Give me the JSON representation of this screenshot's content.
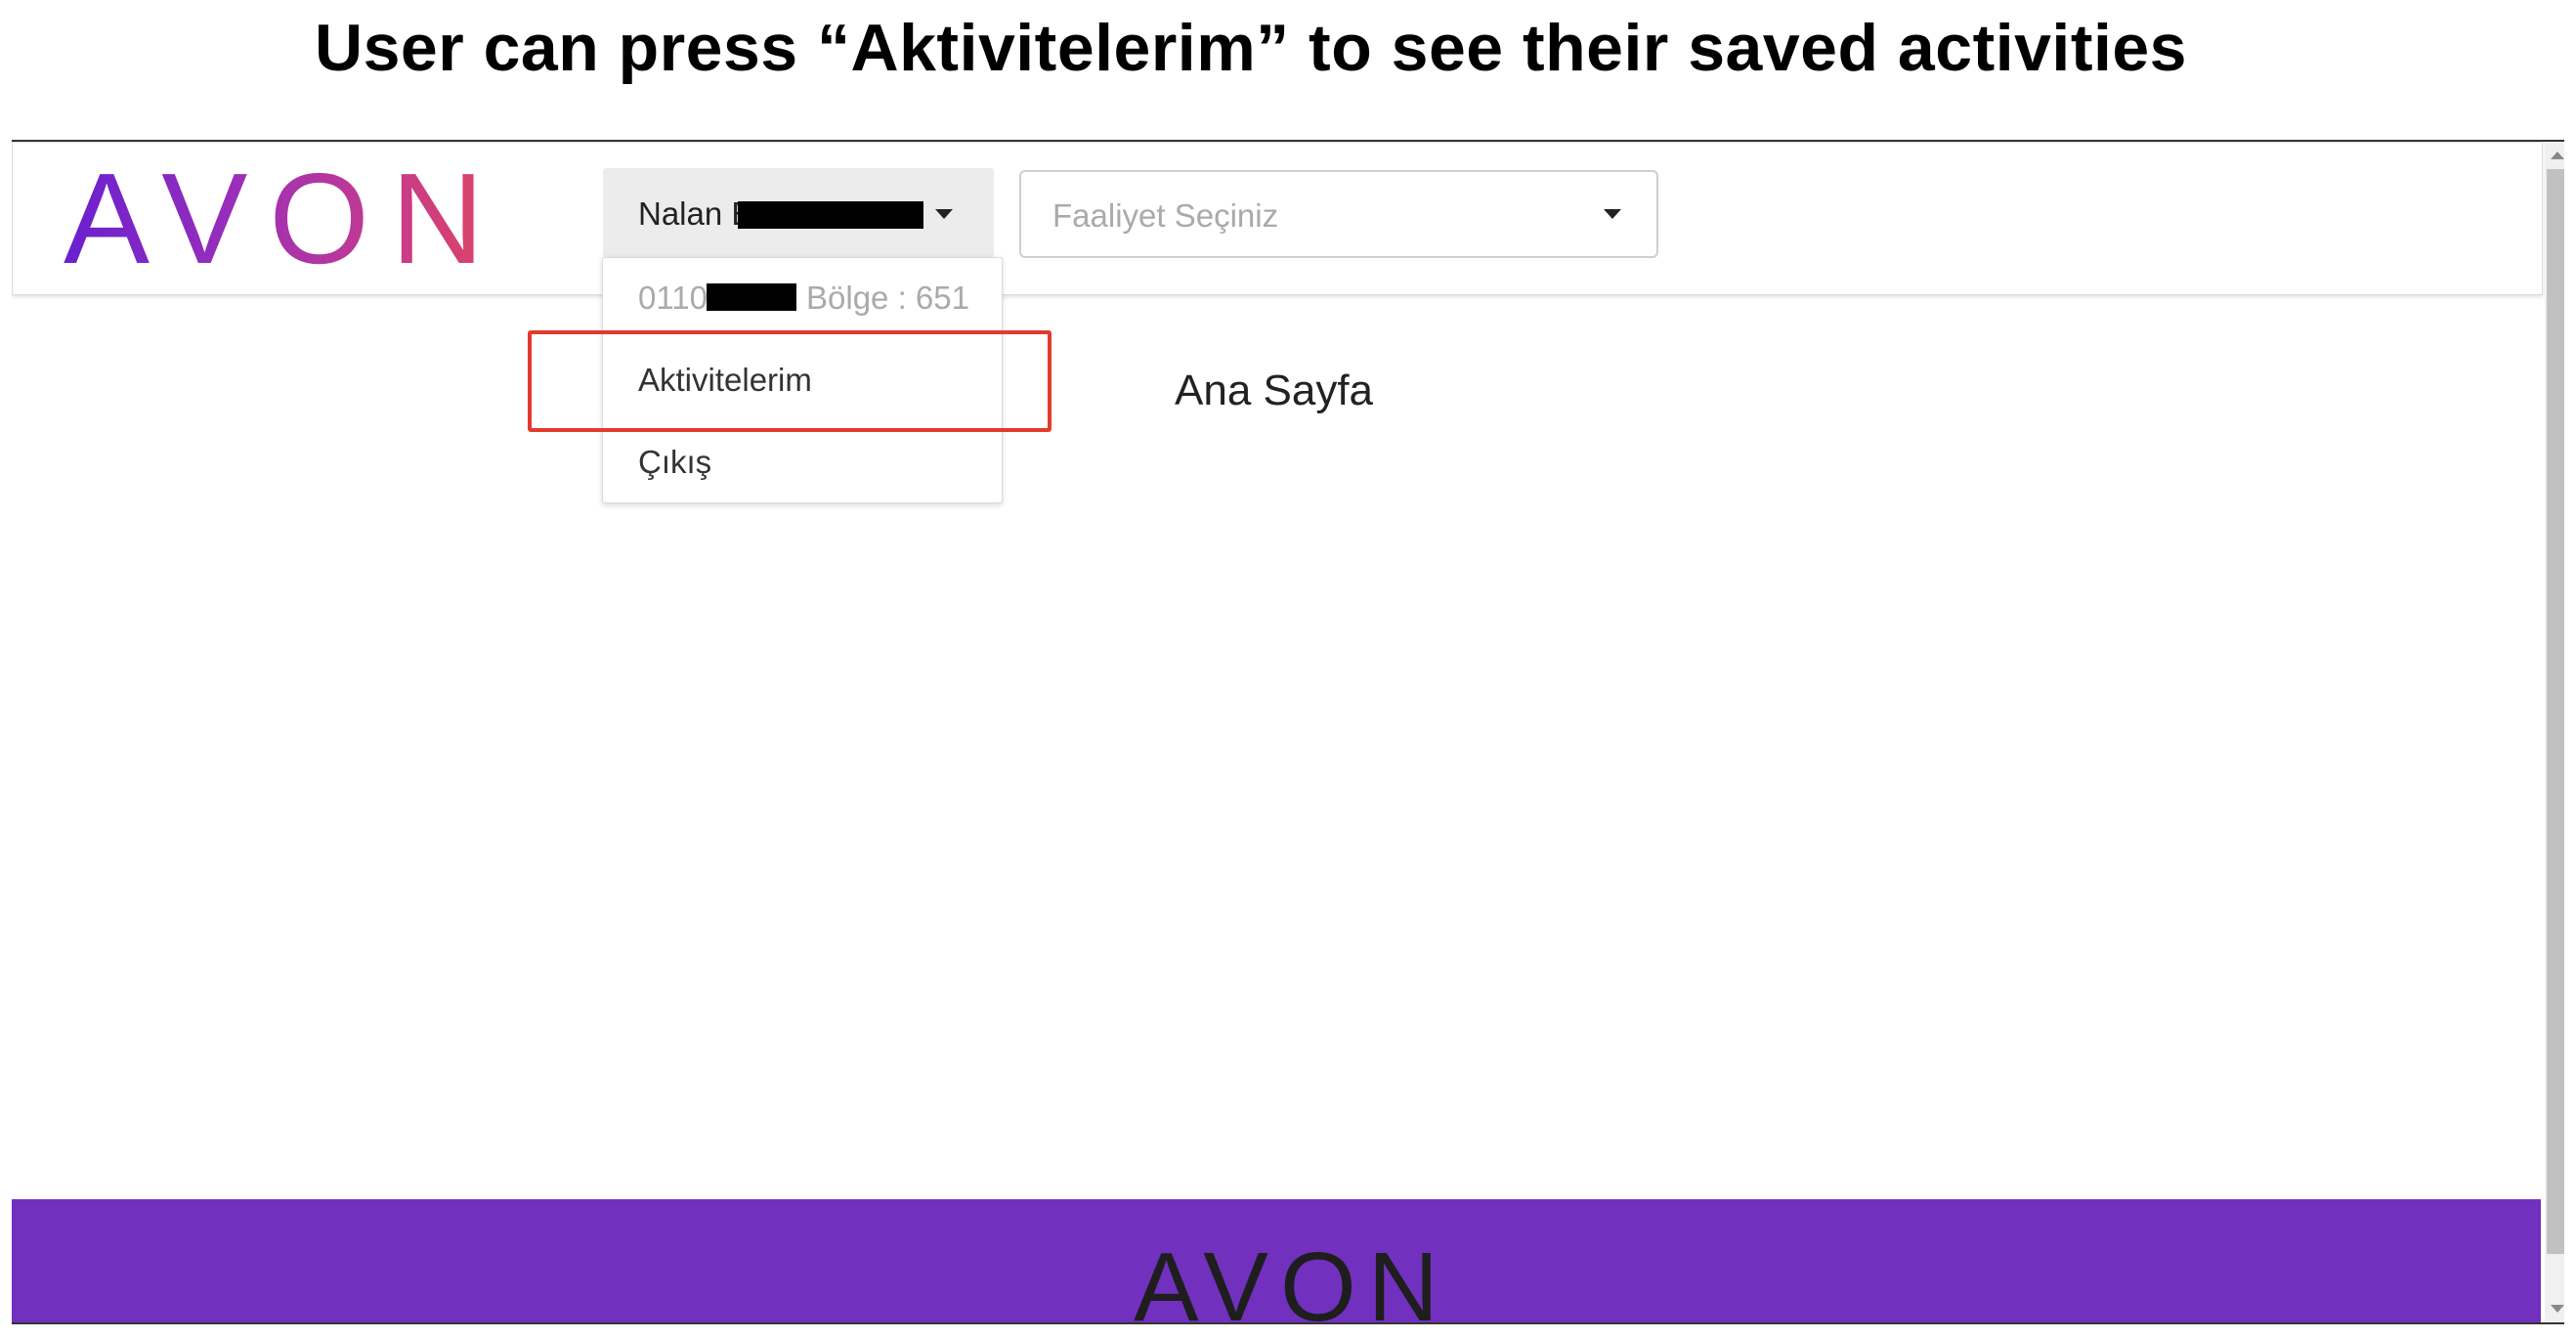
{
  "caption": "User can press “Aktivitelerim” to see their saved activities",
  "header": {
    "logo": "AVON",
    "user_button": {
      "name_prefix": "Nalan E",
      "caret_icon": "caret-down-icon"
    },
    "activity_select": {
      "placeholder": "Faaliyet Seçiniz",
      "caret_icon": "caret-down-icon"
    }
  },
  "dropdown": {
    "info_prefix": "0110",
    "region": "Bölge : 651",
    "items": [
      {
        "label": "Aktivitelerim"
      },
      {
        "label": "Çıkış"
      }
    ]
  },
  "main": {
    "page_title": "Ana Sayfa"
  },
  "footer": {
    "logo": "AVON"
  },
  "colors": {
    "brand_purple": "#7230be",
    "highlight_red": "#e23b2e",
    "logo_gradient_start": "#6a1fd0",
    "logo_gradient_end": "#e04563"
  }
}
